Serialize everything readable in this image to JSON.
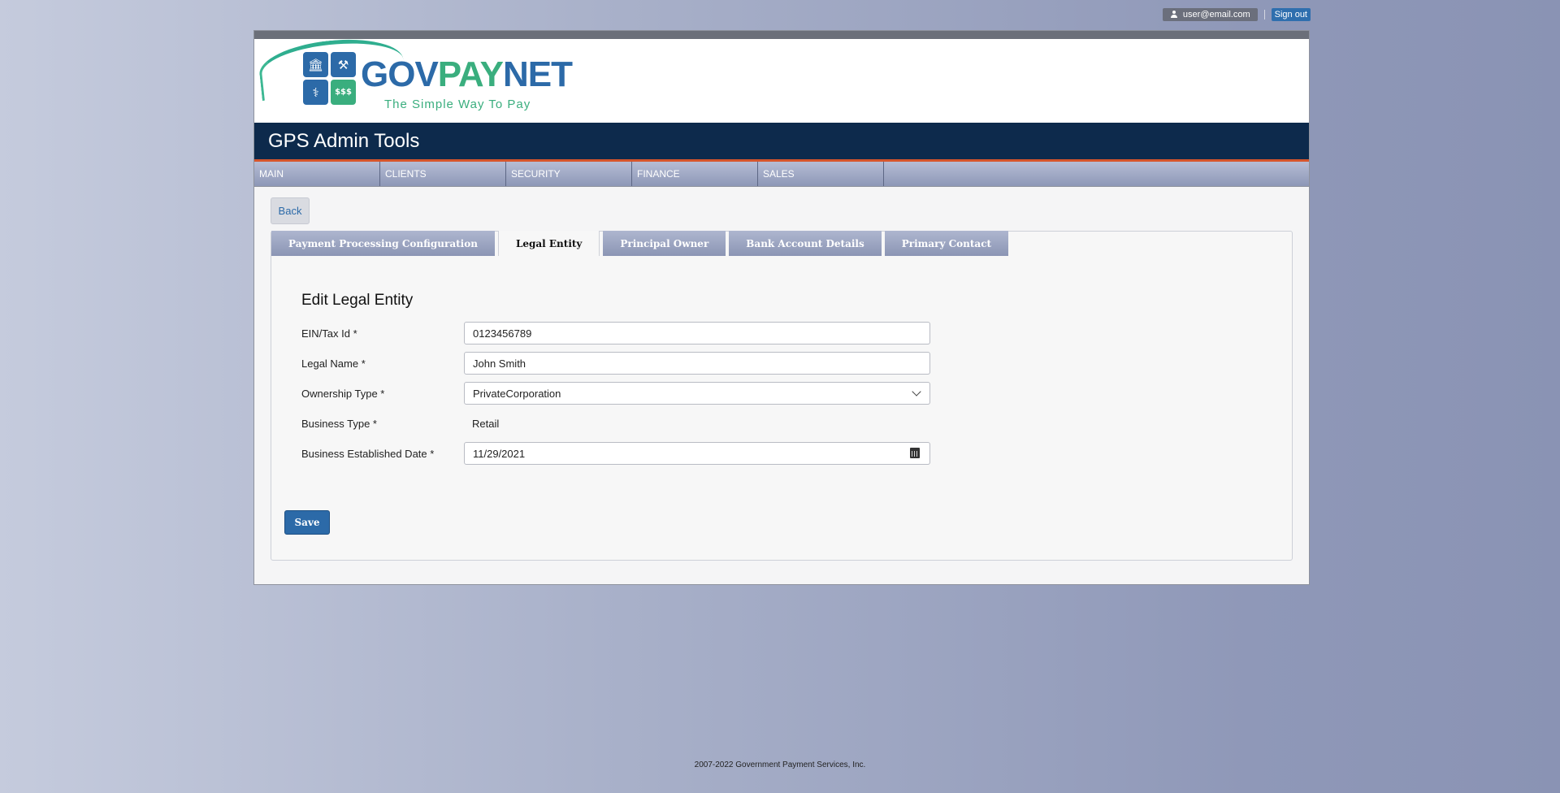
{
  "user": {
    "email": "user@email.com",
    "signout_label": "Sign out"
  },
  "brand": {
    "word_gov": "GOV",
    "word_pay": "PAY",
    "word_net": "NET",
    "tagline": "The Simple Way To Pay",
    "tile4_text": "$$$"
  },
  "app_title": "GPS Admin Tools",
  "nav": {
    "items": [
      {
        "label": "MAIN"
      },
      {
        "label": "CLIENTS"
      },
      {
        "label": "SECURITY"
      },
      {
        "label": "FINANCE"
      },
      {
        "label": "SALES"
      }
    ]
  },
  "back_label": "Back",
  "tabs": [
    {
      "label": "Payment Processing Configuration",
      "active": false
    },
    {
      "label": "Legal Entity",
      "active": true
    },
    {
      "label": "Principal Owner",
      "active": false
    },
    {
      "label": "Bank Account Details",
      "active": false
    },
    {
      "label": "Primary Contact",
      "active": false
    }
  ],
  "form": {
    "title": "Edit Legal Entity",
    "ein": {
      "label": "EIN/Tax Id *",
      "value": "0123456789"
    },
    "legal_name": {
      "label": "Legal Name *",
      "value": "John Smith"
    },
    "ownership_type": {
      "label": "Ownership Type *",
      "value": "PrivateCorporation"
    },
    "business_type": {
      "label": "Business Type *",
      "value": "Retail"
    },
    "established_date": {
      "label": "Business Established Date *",
      "value": "11/29/2021"
    },
    "save_label": "Save"
  },
  "footer": "2007-2022 Government Payment Services, Inc.",
  "colors": {
    "primary": "#2c6aa8",
    "brand_green": "#3aae7e",
    "header_bg": "#0d2a4c",
    "accent_orange": "#d6552b"
  }
}
